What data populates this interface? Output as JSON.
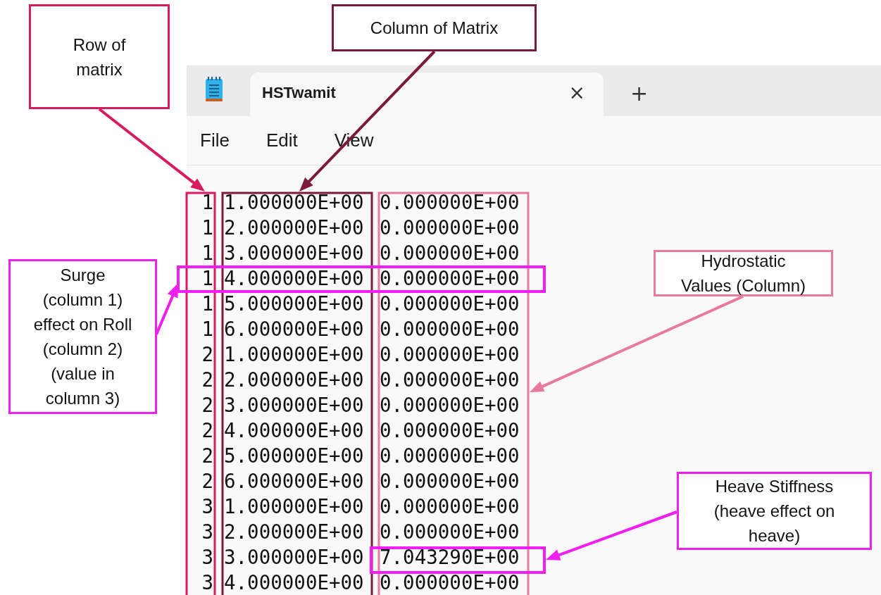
{
  "window": {
    "title": "HSTwamit",
    "close_glyph": "×",
    "new_tab_glyph": "+"
  },
  "menu": [
    "File",
    "Edit",
    "View"
  ],
  "rows": [
    {
      "cells": [
        "1",
        "1.000000E+00",
        "0.000000E+00"
      ],
      "row_highlighted": false,
      "value_highlighted": false
    },
    {
      "cells": [
        "1",
        "2.000000E+00",
        "0.000000E+00"
      ],
      "row_highlighted": false,
      "value_highlighted": false
    },
    {
      "cells": [
        "1",
        "3.000000E+00",
        "0.000000E+00"
      ],
      "row_highlighted": false,
      "value_highlighted": false
    },
    {
      "cells": [
        "1",
        "4.000000E+00",
        "0.000000E+00"
      ],
      "row_highlighted": true,
      "value_highlighted": false
    },
    {
      "cells": [
        "1",
        "5.000000E+00",
        "0.000000E+00"
      ],
      "row_highlighted": false,
      "value_highlighted": false
    },
    {
      "cells": [
        "1",
        "6.000000E+00",
        "0.000000E+00"
      ],
      "row_highlighted": false,
      "value_highlighted": false
    },
    {
      "cells": [
        "2",
        "1.000000E+00",
        "0.000000E+00"
      ],
      "row_highlighted": false,
      "value_highlighted": false
    },
    {
      "cells": [
        "2",
        "2.000000E+00",
        "0.000000E+00"
      ],
      "row_highlighted": false,
      "value_highlighted": false
    },
    {
      "cells": [
        "2",
        "3.000000E+00",
        "0.000000E+00"
      ],
      "row_highlighted": false,
      "value_highlighted": false
    },
    {
      "cells": [
        "2",
        "4.000000E+00",
        "0.000000E+00"
      ],
      "row_highlighted": false,
      "value_highlighted": false
    },
    {
      "cells": [
        "2",
        "5.000000E+00",
        "0.000000E+00"
      ],
      "row_highlighted": false,
      "value_highlighted": false
    },
    {
      "cells": [
        "2",
        "6.000000E+00",
        "0.000000E+00"
      ],
      "row_highlighted": false,
      "value_highlighted": false
    },
    {
      "cells": [
        "3",
        "1.000000E+00",
        "0.000000E+00"
      ],
      "row_highlighted": false,
      "value_highlighted": false
    },
    {
      "cells": [
        "3",
        "2.000000E+00",
        "0.000000E+00"
      ],
      "row_highlighted": false,
      "value_highlighted": false
    },
    {
      "cells": [
        "3",
        "3.000000E+00",
        "7.043290E+00"
      ],
      "row_highlighted": false,
      "value_highlighted": true
    },
    {
      "cells": [
        "3",
        "4.000000E+00",
        "0.000000E+00"
      ],
      "row_highlighted": false,
      "value_highlighted": false
    }
  ],
  "column_frames": [
    {
      "color": "#d81b60"
    },
    {
      "color": "#7b1a3a"
    },
    {
      "color": "#e8799f"
    }
  ],
  "callouts": [
    {
      "text": "Row of\nmatrix",
      "color": "#d81b60"
    },
    {
      "text": "Column of Matrix",
      "color": "#7b1a3a"
    },
    {
      "text": "Surge\n(column 1)\neffect on Roll\n(column 2)\n(value in\ncolumn 3)",
      "color": "#f01ef0"
    },
    {
      "text": "Hydrostatic\nValues (Column)",
      "color": "#e8799f"
    },
    {
      "text": "Heave Stiffness\n(heave effect on\nheave)",
      "color": "#f01ef0"
    }
  ]
}
